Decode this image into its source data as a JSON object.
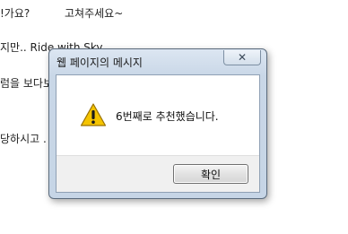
{
  "background": {
    "line1": "!가요?",
    "line1b": "고쳐주세요~",
    "line2": "지만.. Ride with Sky",
    "line3": "럼을 보다보",
    "line4": "당하시고 ."
  },
  "dialog": {
    "title": "웹 페이지의 메시지",
    "close_label": "✕",
    "icon": "warning-icon",
    "message": "6번째로 추천했습니다.",
    "ok_label": "확인",
    "colors": {
      "frame": "#c6d5e6",
      "warning": "#f5c400"
    }
  }
}
